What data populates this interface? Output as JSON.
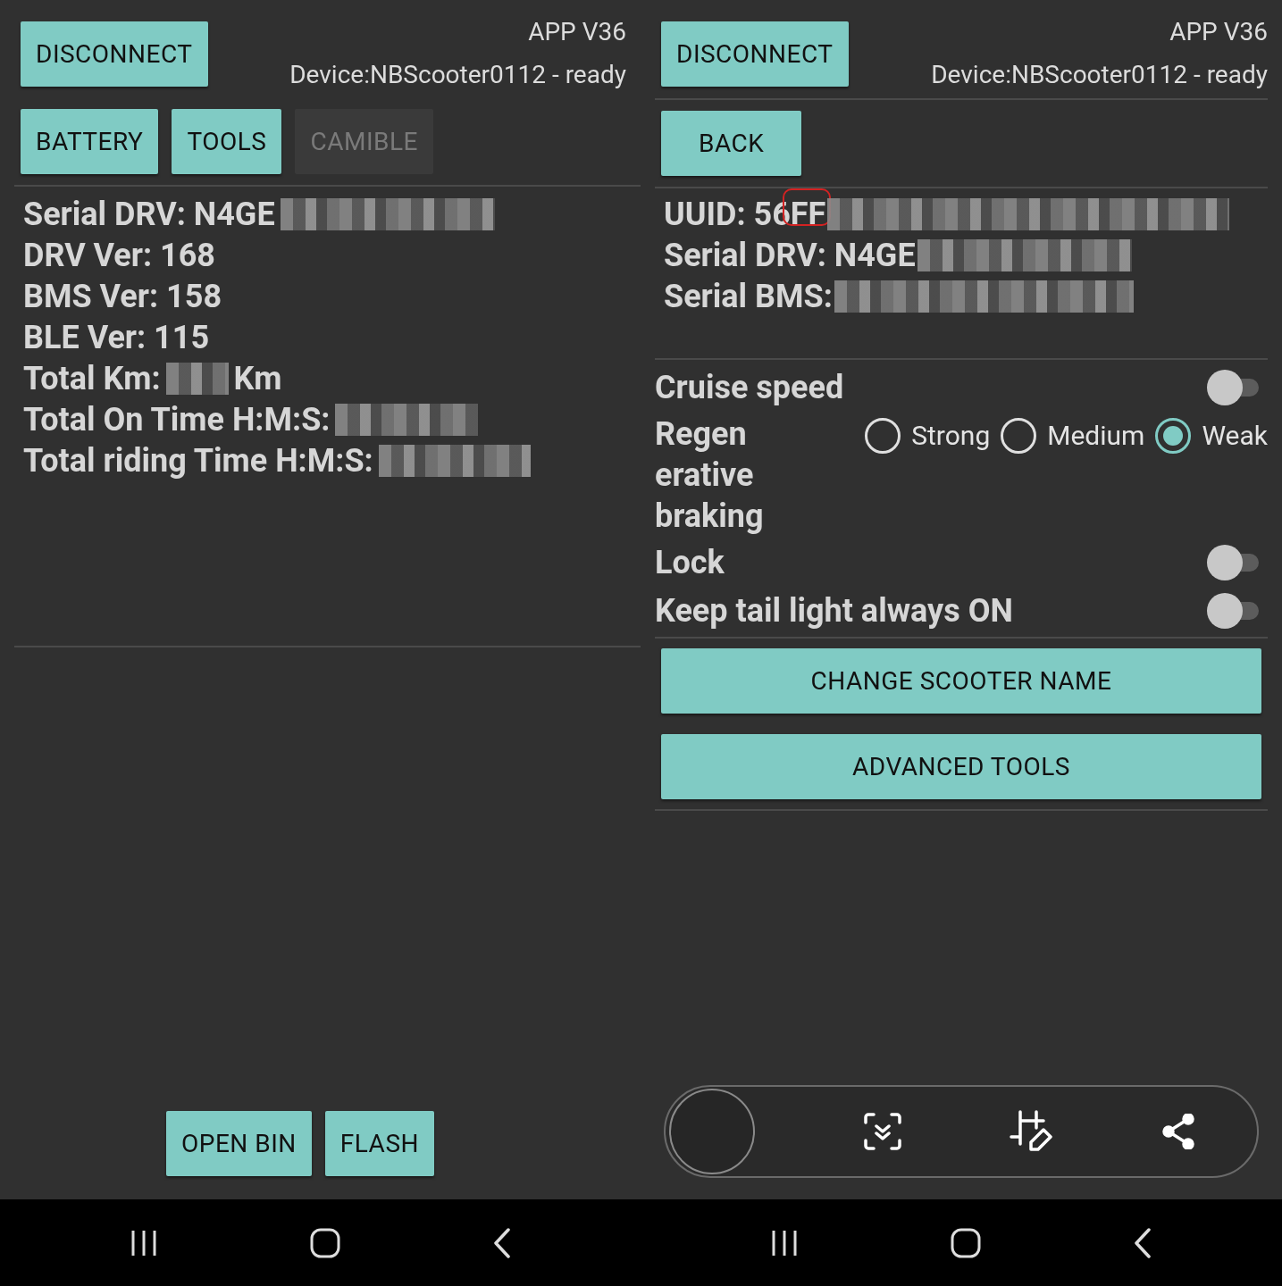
{
  "left_screen": {
    "disconnect_button": "DISCONNECT",
    "app_version": "APP V36",
    "device_status": "Device:NBScooter0112 - ready",
    "tabs": [
      {
        "label": "BATTERY",
        "disabled": false
      },
      {
        "label": "TOOLS",
        "disabled": false
      },
      {
        "label": "CAMIBLE",
        "disabled": true
      }
    ],
    "info_lines": [
      {
        "label": "Serial DRV: N4GE",
        "redacted": true
      },
      {
        "label": "DRV Ver: 168",
        "redacted": false
      },
      {
        "label": "BMS Ver: 158",
        "redacted": false
      },
      {
        "label": "BLE Ver: 115",
        "redacted": false
      },
      {
        "label": "Total Km:",
        "redacted": true,
        "suffix": "Km"
      },
      {
        "label": "Total On Time H:M:S:",
        "redacted": true
      },
      {
        "label": "Total riding Time H:M:S:",
        "redacted": true
      }
    ],
    "bottom_buttons": [
      "OPEN BIN",
      "FLASH"
    ]
  },
  "right_screen": {
    "disconnect_button": "DISCONNECT",
    "app_version": "APP V36",
    "device_status": "Device:NBScooter0112 - ready",
    "back_button": "BACK",
    "info_lines": [
      {
        "label": "UUID: 56FF",
        "redacted": true,
        "highlighted": true
      },
      {
        "label": "Serial DRV: N4GE",
        "redacted": true,
        "highlighted": false
      },
      {
        "label": "Serial BMS:",
        "redacted": true,
        "highlighted": false
      }
    ],
    "settings": [
      {
        "kind": "toggle",
        "label": "Cruise speed",
        "on": false
      },
      {
        "kind": "radio",
        "label_lines": [
          "Regen",
          "erative",
          "braking"
        ],
        "options": [
          {
            "label": "Strong",
            "selected": false
          },
          {
            "label": "Medium",
            "selected": false
          },
          {
            "label": "Weak",
            "selected": true
          }
        ]
      },
      {
        "kind": "toggle",
        "label": "Lock",
        "on": false
      },
      {
        "kind": "toggle",
        "label": "Keep tail light always ON",
        "on": false
      }
    ],
    "action_buttons": [
      "CHANGE SCOOTER NAME",
      "ADVANCED TOOLS"
    ]
  }
}
